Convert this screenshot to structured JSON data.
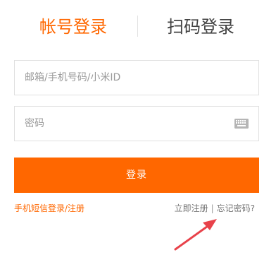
{
  "tabs": {
    "account_login": "帐号登录",
    "qr_login": "扫码登录"
  },
  "form": {
    "username_placeholder": "邮箱/手机号码/小米ID",
    "password_placeholder": "密码",
    "login_button": "登录"
  },
  "links": {
    "sms_login_register": "手机短信登录/注册",
    "register_now": "立即注册",
    "separator": "|",
    "forgot_password": "忘记密码?"
  },
  "icons": {
    "keyboard": "keyboard-icon",
    "annotation_arrow": "arrow-icon"
  },
  "colors": {
    "accent": "#ff6700",
    "annotation": "#e8424a"
  }
}
